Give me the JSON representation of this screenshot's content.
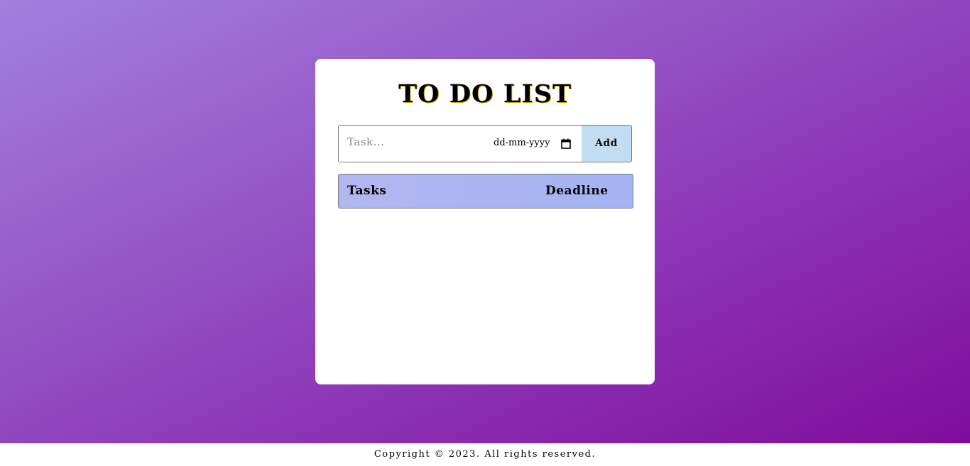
{
  "app": {
    "title": "TO DO LIST"
  },
  "form": {
    "task_placeholder": "Task...",
    "task_value": "",
    "date_placeholder": "dd-mm-yyyy",
    "add_label": "Add"
  },
  "table": {
    "columns": [
      "Tasks",
      "Deadline"
    ],
    "rows": []
  },
  "footer": {
    "copyright": "Copyright © 2023. All rights reserved."
  },
  "icons": {
    "calendar": "calendar-icon"
  },
  "colors": {
    "gradient_start": "#a37fde",
    "gradient_end": "#7f0c9c",
    "add_button": "#c2ddf2",
    "header_bg": "#aab4f2"
  }
}
